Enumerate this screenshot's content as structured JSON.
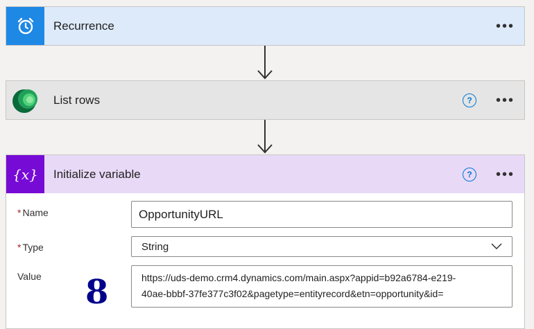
{
  "cards": {
    "recurrence": {
      "title": "Recurrence",
      "color": "#ddeafa",
      "icon_color": "#1e88e5"
    },
    "list_rows": {
      "title": "List rows",
      "color": "#e5e5e5"
    },
    "init_var": {
      "title": "Initialize variable",
      "color": "#e8d9f7",
      "icon_color": "#770bd6",
      "icon_text": "{x}"
    }
  },
  "form": {
    "name_label": "Name",
    "name_value": "OpportunityURL",
    "type_label": "Type",
    "type_value": "String",
    "value_label": "Value",
    "value_line1": "https://uds-demo.crm4.dynamics.com/main.aspx?appid=b92a6784-e219-",
    "value_line2": "40ae-bbbf-37fe377c3f02&pagetype=entityrecord&etn=opportunity&id=",
    "required_mark": "*"
  },
  "annotation": {
    "number": "8"
  },
  "icons": {
    "more": "more-icon",
    "help": "help-icon",
    "arrow": "arrow-down-icon",
    "chevron": "chevron-down-icon"
  }
}
